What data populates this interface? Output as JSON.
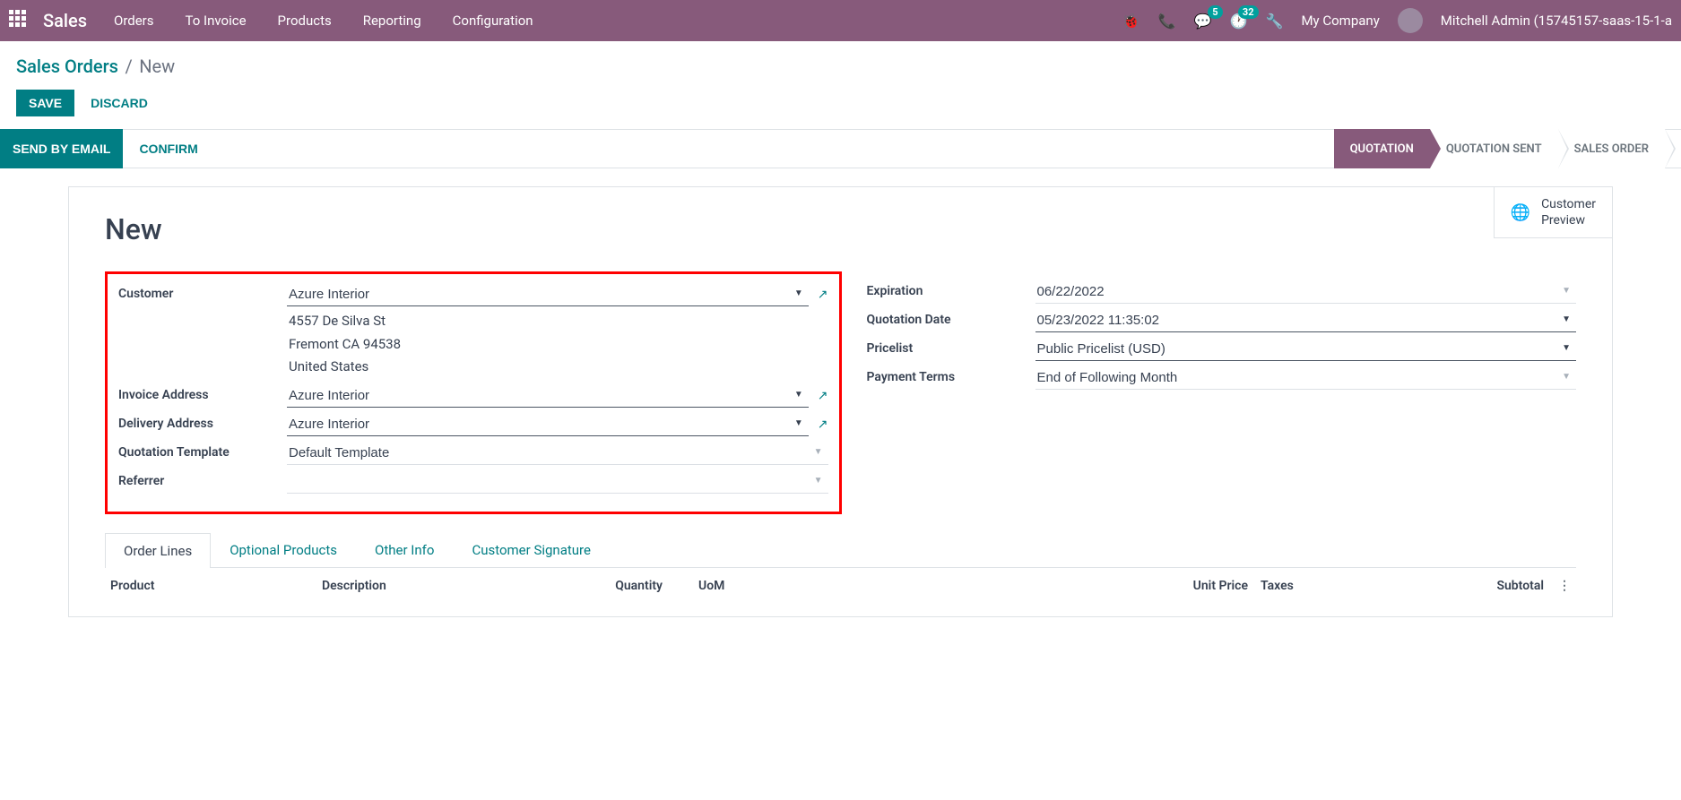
{
  "topbar": {
    "app_name": "Sales",
    "menu": [
      "Orders",
      "To Invoice",
      "Products",
      "Reporting",
      "Configuration"
    ],
    "chat_badge": "5",
    "activity_badge": "32",
    "company": "My Company",
    "user": "Mitchell Admin (15745157-saas-15-1-a"
  },
  "breadcrumb": {
    "root": "Sales Orders",
    "current": "New"
  },
  "actions": {
    "save": "SAVE",
    "discard": "DISCARD",
    "send_email": "SEND BY EMAIL",
    "confirm": "CONFIRM"
  },
  "status_steps": [
    "QUOTATION",
    "QUOTATION SENT",
    "SALES ORDER"
  ],
  "preview": {
    "line1": "Customer",
    "line2": "Preview"
  },
  "record": {
    "title": "New",
    "left": {
      "customer_label": "Customer",
      "customer_value": "Azure Interior",
      "address": {
        "street": "4557 De Silva St",
        "city": "Fremont CA 94538",
        "country": "United States"
      },
      "invoice_addr_label": "Invoice Address",
      "invoice_addr_value": "Azure Interior",
      "delivery_addr_label": "Delivery Address",
      "delivery_addr_value": "Azure Interior",
      "quote_tmpl_label": "Quotation Template",
      "quote_tmpl_value": "Default Template",
      "referrer_label": "Referrer",
      "referrer_value": ""
    },
    "right": {
      "expiration_label": "Expiration",
      "expiration_value": "06/22/2022",
      "quote_date_label": "Quotation Date",
      "quote_date_value": "05/23/2022 11:35:02",
      "pricelist_label": "Pricelist",
      "pricelist_value": "Public Pricelist (USD)",
      "payment_terms_label": "Payment Terms",
      "payment_terms_value": "End of Following Month"
    }
  },
  "tabs": [
    "Order Lines",
    "Optional Products",
    "Other Info",
    "Customer Signature"
  ],
  "table": {
    "product": "Product",
    "description": "Description",
    "quantity": "Quantity",
    "uom": "UoM",
    "unit_price": "Unit Price",
    "taxes": "Taxes",
    "subtotal": "Subtotal"
  }
}
